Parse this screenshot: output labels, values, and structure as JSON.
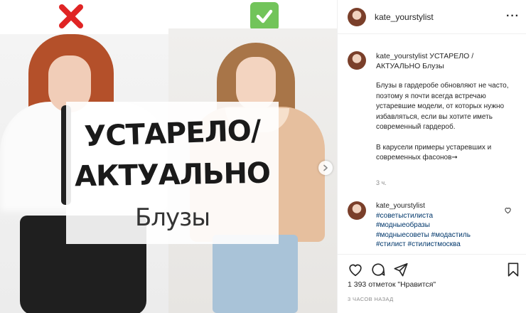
{
  "post": {
    "username": "kate_yourstylist",
    "overlay_title_line1": "УСТАРЕЛО/",
    "overlay_title_line2": "АКТУАЛЬНО",
    "overlay_subtitle": "Блузы"
  },
  "caption": {
    "username": "kate_yourstylist",
    "title_text": "УСТАРЕЛО / АКТУАЛЬНО Блузы",
    "paragraph1": "Блузы в гардеробе обновляют не часто, поэтому я почти всегда встречаю устаревшие модели, от которых нужно избавляться, если вы хотите иметь современный гардероб.",
    "paragraph2": "В карусели примеры устаревших и современных фасонов➞",
    "time": "3 ч."
  },
  "comment": {
    "username": "kate_yourstylist",
    "tags": [
      "#советыстилиста",
      "#модныеобразы",
      "#модныесоветы",
      "#модастиль",
      "#стилист",
      "#стилистмосква"
    ]
  },
  "stats": {
    "likes_text": "1 393 отметок \"Нравится\"",
    "posted_ago": "3 ЧАСОВ НАЗАД"
  },
  "icons": {
    "wrong": "cross-mark-icon",
    "right": "check-mark-icon",
    "more": "more-options-icon",
    "like": "heart-icon",
    "comment": "comment-icon",
    "share": "share-icon",
    "save": "bookmark-icon",
    "next": "chevron-right-icon"
  },
  "colors": {
    "cross": "#e02424",
    "check_bg": "#72c45a",
    "hashtag": "#00376b",
    "muted": "#8e8e8e"
  }
}
